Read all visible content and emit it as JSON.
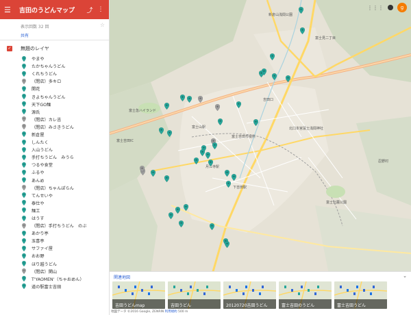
{
  "header": {
    "title": "吉田のうどんマップ",
    "menu_icon": "menu-icon",
    "share_icon": "share-icon",
    "more_icon": "more-vert-icon"
  },
  "meta": {
    "views": "表示回数 32 回",
    "share_link": "共有"
  },
  "layer": {
    "name": "無題のレイヤ",
    "checked": true
  },
  "places": [
    {
      "name": "やまや",
      "pin": "teal"
    },
    {
      "name": "たかちゃんうどん",
      "pin": "teal"
    },
    {
      "name": "くれちうどん",
      "pin": "teal"
    },
    {
      "name": "（閉店）多キロ",
      "pin": "gray"
    },
    {
      "name": "開花",
      "pin": "teal"
    },
    {
      "name": "きよちゃんうどん",
      "pin": "teal"
    },
    {
      "name": "天下GO麺",
      "pin": "teal"
    },
    {
      "name": "源氏",
      "pin": "teal"
    },
    {
      "name": "（閉店）カレ吉",
      "pin": "gray"
    },
    {
      "name": "（閉店）みさきうどん",
      "pin": "gray"
    },
    {
      "name": "新倉屋",
      "pin": "teal"
    },
    {
      "name": "しんたく",
      "pin": "teal"
    },
    {
      "name": "入山うどん",
      "pin": "teal"
    },
    {
      "name": "手打ちうどん　みうら",
      "pin": "teal"
    },
    {
      "name": "つるや食堂",
      "pin": "teal"
    },
    {
      "name": "ふるや",
      "pin": "teal"
    },
    {
      "name": "あんめ",
      "pin": "teal"
    },
    {
      "name": "（閉店）ちゃんぽらん",
      "pin": "gray"
    },
    {
      "name": "てんせいや",
      "pin": "teal"
    },
    {
      "name": "泰仕や",
      "pin": "teal"
    },
    {
      "name": "麺工",
      "pin": "teal"
    },
    {
      "name": "はうす",
      "pin": "teal"
    },
    {
      "name": "（閉店）手打ちうどん　のぶ",
      "pin": "gray"
    },
    {
      "name": "あかり亭",
      "pin": "teal"
    },
    {
      "name": "玉喜亭",
      "pin": "teal"
    },
    {
      "name": "サファイ屋",
      "pin": "teal"
    },
    {
      "name": "おお野",
      "pin": "teal"
    },
    {
      "name": "ほり越うどん",
      "pin": "teal"
    },
    {
      "name": "（閉店）関山",
      "pin": "gray"
    },
    {
      "name": "T'YAOMEN'（ちゃおめん）",
      "pin": "teal"
    },
    {
      "name": "道の駅富士吉田",
      "pin": "teal"
    }
  ],
  "map_labels": [
    {
      "text": "新倉山浅間公園",
      "id": "label-arakurayama"
    },
    {
      "text": "富士見二丁目",
      "id": "label-fujimi"
    },
    {
      "text": "富士吉田IC",
      "id": "label-ic"
    },
    {
      "text": "富士急ハイランド",
      "id": "label-highland"
    },
    {
      "text": "吉田口",
      "id": "label-yoshidaguchi"
    },
    {
      "text": "富士吉田市役所",
      "id": "label-cityhall"
    },
    {
      "text": "富士山駅",
      "id": "label-fujisan-station"
    },
    {
      "text": "月江寺駅",
      "id": "label-gekkoji"
    },
    {
      "text": "下吉田駅",
      "id": "label-shimoyoshida"
    },
    {
      "text": "富士北麓公園",
      "id": "label-hokuroku"
    },
    {
      "text": "北口本宮冨士浅間神社",
      "id": "label-sengen"
    },
    {
      "text": "忍野村",
      "id": "label-oshino"
    }
  ],
  "map_pins": [
    {
      "pin": "teal"
    },
    {
      "pin": "teal"
    },
    {
      "pin": "teal"
    },
    {
      "pin": "teal"
    },
    {
      "pin": "teal"
    },
    {
      "pin": "teal"
    },
    {
      "pin": "teal"
    },
    {
      "pin": "teal"
    },
    {
      "pin": "teal"
    },
    {
      "pin": "teal"
    },
    {
      "pin": "gray"
    },
    {
      "pin": "gray"
    },
    {
      "pin": "teal"
    },
    {
      "pin": "teal"
    },
    {
      "pin": "teal"
    },
    {
      "pin": "teal"
    },
    {
      "pin": "teal"
    },
    {
      "pin": "gray"
    },
    {
      "pin": "teal"
    },
    {
      "pin": "teal"
    },
    {
      "pin": "teal"
    },
    {
      "pin": "teal"
    },
    {
      "pin": "teal"
    },
    {
      "pin": "teal"
    },
    {
      "pin": "gray"
    },
    {
      "pin": "teal"
    },
    {
      "pin": "teal"
    },
    {
      "pin": "teal"
    },
    {
      "pin": "teal"
    },
    {
      "pin": "teal"
    },
    {
      "pin": "teal"
    },
    {
      "pin": "teal"
    },
    {
      "pin": "teal"
    },
    {
      "pin": "teal"
    },
    {
      "pin": "teal"
    },
    {
      "pin": "teal"
    },
    {
      "pin": "teal"
    },
    {
      "pin": "gray"
    }
  ],
  "topbar": {
    "apps_icon": "apps-icon",
    "notifications_icon": "notifications-icon",
    "avatar_letter": "g"
  },
  "related": {
    "title": "関連地図",
    "chevron_icon": "chevron-down-icon",
    "cards": [
      {
        "label": "吉田うどんmap"
      },
      {
        "label": "吉田うどん"
      },
      {
        "label": "20120720吉田うどん"
      },
      {
        "label": "富士吉田のうどん"
      },
      {
        "label": "富士吉田うどん"
      }
    ]
  },
  "footer": {
    "copyright": "地図データ ©2016 Google, ZENRIN",
    "terms": "利用規約",
    "scale": "500 m"
  },
  "colors": {
    "header_bg": "#db4437",
    "pin_teal": "#26a69a",
    "pin_gray": "#9e9e9e",
    "link": "#3367d6",
    "avatar": "#f57c00"
  }
}
